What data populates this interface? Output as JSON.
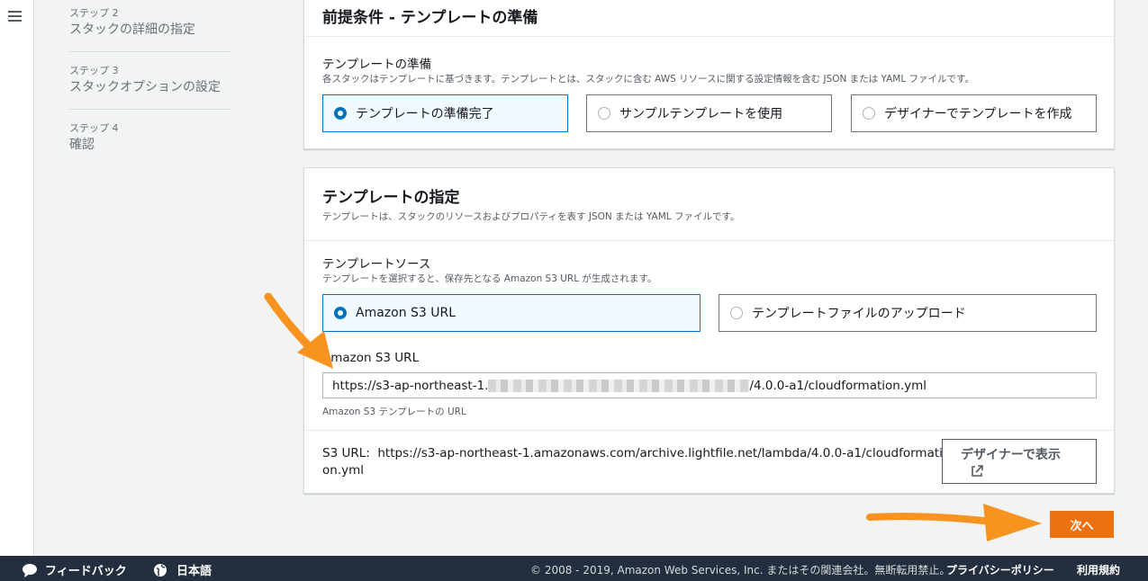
{
  "steps": [
    {
      "num": "ステップ 2",
      "title": "スタックの詳細の指定"
    },
    {
      "num": "ステップ 3",
      "title": "スタックオプションの設定"
    },
    {
      "num": "ステップ 4",
      "title": "確認"
    }
  ],
  "prereq": {
    "title": "前提条件 - テンプレートの準備",
    "field_label": "テンプレートの準備",
    "field_desc": "各スタックはテンプレートに基づきます。テンプレートとは、スタックに含む AWS リソースに関する設定情報を含む JSON または YAML ファイルです。",
    "options": [
      "テンプレートの準備完了",
      "サンプルテンプレートを使用",
      "デザイナーでテンプレートを作成"
    ],
    "selected_index": 0
  },
  "template": {
    "title": "テンプレートの指定",
    "desc": "テンプレートは、スタックのリソースおよびプロパティを表す JSON または YAML ファイルです。",
    "source_label": "テンプレートソース",
    "source_desc": "テンプレートを選択すると、保存先となる Amazon S3 URL が生成されます。",
    "source_options": [
      "Amazon S3 URL",
      "テンプレートファイルのアップロード"
    ],
    "selected_index": 0,
    "url_label": "Amazon S3 URL",
    "url_value_prefix": "https://s3-ap-northeast-1.",
    "url_value_suffix": "/4.0.0-a1/cloudformation.yml",
    "url_hint": "Amazon S3 テンプレートの URL",
    "s3_url_label": "S3 URL:",
    "s3_url_value": "https://s3-ap-northeast-1.amazonaws.com/archive.lightfile.net/lambda/4.0.0-a1/cloudformation.yml",
    "designer_button": "デザイナーで表示"
  },
  "actions": {
    "next_label": "次へ"
  },
  "footer": {
    "feedback": "フィードバック",
    "language": "日本語",
    "copyright": "© 2008 - 2019, Amazon Web Services, Inc. またはその関連会社。無断転用禁止。",
    "privacy": "プライバシーポリシー",
    "terms": "利用規約"
  },
  "colors": {
    "accent": "#0073bb",
    "primary_button": "#ec7211",
    "annotation_arrow": "#f7931e",
    "footer_bg": "#232f3e"
  },
  "icons": [
    "hamburger-menu-icon",
    "external-link-icon",
    "speech-bubble-icon",
    "globe-icon",
    "orange-arrow-annotation"
  ]
}
